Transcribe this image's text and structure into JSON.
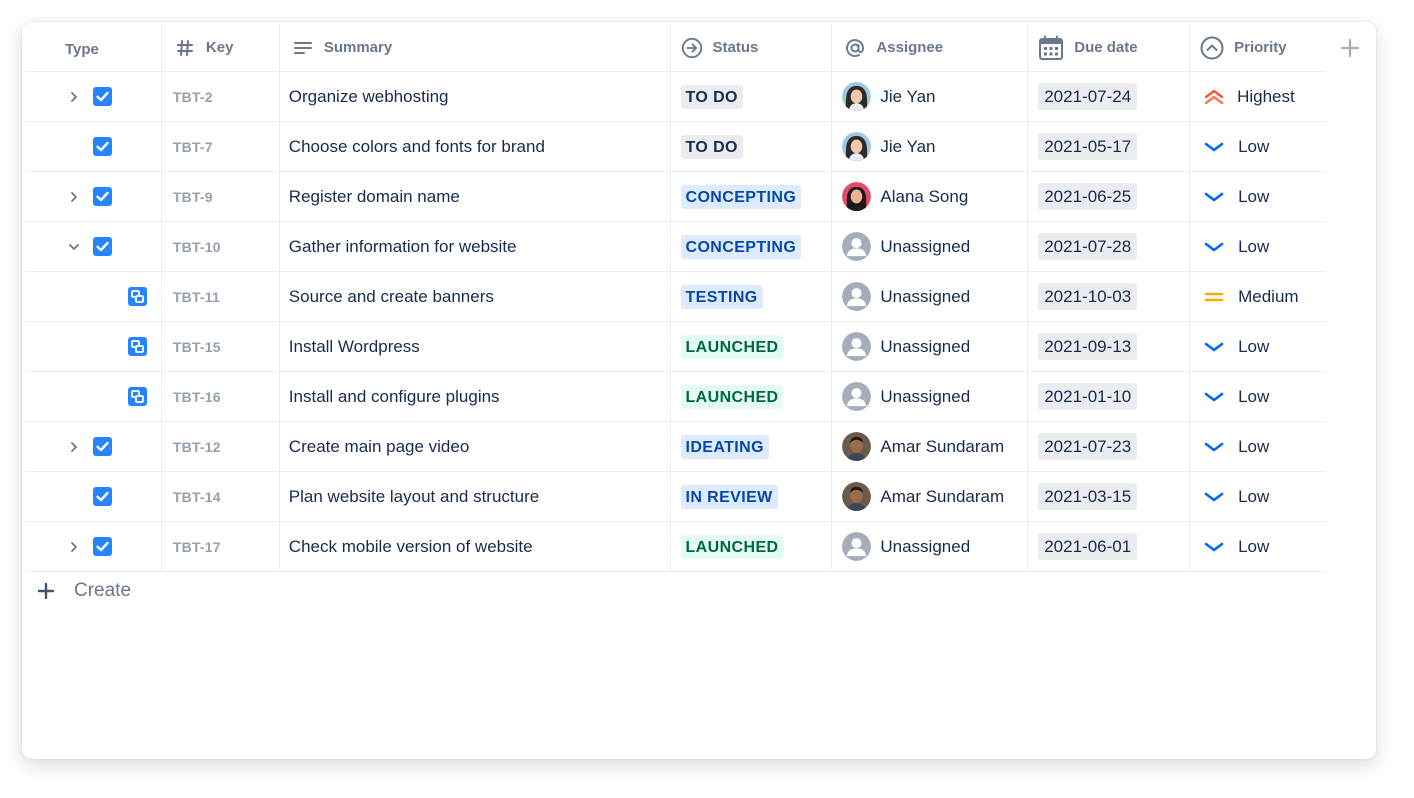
{
  "columns": {
    "type": "Type",
    "key": "Key",
    "summary": "Summary",
    "status": "Status",
    "assignee": "Assignee",
    "due_date": "Due date",
    "priority": "Priority"
  },
  "colors": {
    "accent": "#2684ff",
    "lozenge_gray": "#ebecf0",
    "lozenge_blue": "#deebff",
    "lozenge_green": "#e3fcef",
    "priority_highest": "#ff5630",
    "priority_low": "#0065ff",
    "priority_medium": "#ffab00"
  },
  "rows": [
    {
      "key": "TBT-2",
      "summary": "Organize webhosting",
      "status": "TO DO",
      "assignee": "Jie Yan",
      "due": "2021-07-24",
      "priority": "Highest"
    },
    {
      "key": "TBT-7",
      "summary": "Choose colors and fonts for brand",
      "status": "TO DO",
      "assignee": "Jie Yan",
      "due": "2021-05-17",
      "priority": "Low"
    },
    {
      "key": "TBT-9",
      "summary": "Register domain name",
      "status": "CONCEPTING",
      "assignee": "Alana Song",
      "due": "2021-06-25",
      "priority": "Low"
    },
    {
      "key": "TBT-10",
      "summary": "Gather information for website",
      "status": "CONCEPTING",
      "assignee": "Unassigned",
      "due": "2021-07-28",
      "priority": "Low"
    },
    {
      "key": "TBT-11",
      "summary": "Source and create banners",
      "status": "TESTING",
      "assignee": "Unassigned",
      "due": "2021-10-03",
      "priority": "Medium"
    },
    {
      "key": "TBT-15",
      "summary": "Install Wordpress",
      "status": "LAUNCHED",
      "assignee": "Unassigned",
      "due": "2021-09-13",
      "priority": "Low"
    },
    {
      "key": "TBT-16",
      "summary": "Install and configure plugins",
      "status": "LAUNCHED",
      "assignee": "Unassigned",
      "due": "2021-01-10",
      "priority": "Low"
    },
    {
      "key": "TBT-12",
      "summary": "Create main page video",
      "status": "IDEATING",
      "assignee": "Amar Sundaram",
      "due": "2021-07-23",
      "priority": "Low"
    },
    {
      "key": "TBT-14",
      "summary": "Plan website layout and structure",
      "status": "IN REVIEW",
      "assignee": "Amar Sundaram",
      "due": "2021-03-15",
      "priority": "Low"
    },
    {
      "key": "TBT-17",
      "summary": "Check mobile version of website",
      "status": "LAUNCHED",
      "assignee": "Unassigned",
      "due": "2021-06-01",
      "priority": "Low"
    }
  ],
  "create_label": "Create"
}
